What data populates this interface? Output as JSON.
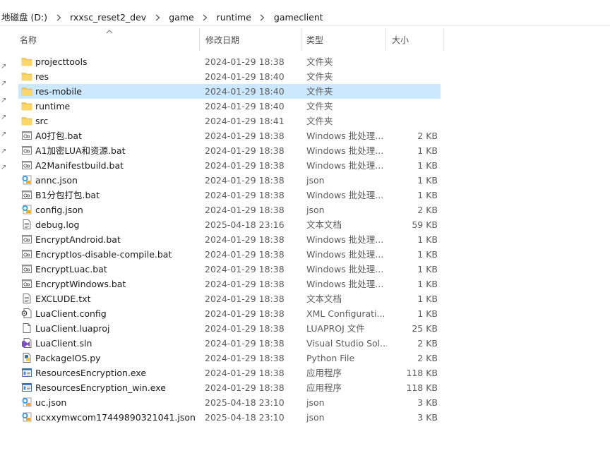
{
  "breadcrumb": [
    "地磁盘 (D:)",
    "rxxsc_reset2_dev",
    "game",
    "runtime",
    "gameclient"
  ],
  "columns": {
    "name": "名称",
    "date": "修改日期",
    "type": "类型",
    "size": "大小"
  },
  "files": [
    {
      "icon": "folder-icon",
      "name": "projecttools",
      "date": "2024-01-29 18:38",
      "type": "文件夹",
      "size": ""
    },
    {
      "icon": "folder-icon",
      "name": "res",
      "date": "2024-01-29 18:40",
      "type": "文件夹",
      "size": ""
    },
    {
      "icon": "folder-icon",
      "name": "res-mobile",
      "date": "2024-01-29 18:40",
      "type": "文件夹",
      "size": "",
      "selected": true
    },
    {
      "icon": "folder-icon",
      "name": "runtime",
      "date": "2024-01-29 18:40",
      "type": "文件夹",
      "size": ""
    },
    {
      "icon": "folder-icon",
      "name": "src",
      "date": "2024-01-29 18:41",
      "type": "文件夹",
      "size": ""
    },
    {
      "icon": "batch-file-icon",
      "name": "A0打包.bat",
      "date": "2024-01-29 18:38",
      "type": "Windows 批处理...",
      "size": "2 KB"
    },
    {
      "icon": "batch-file-icon",
      "name": "A1加密LUA和资源.bat",
      "date": "2024-01-29 18:38",
      "type": "Windows 批处理...",
      "size": "1 KB"
    },
    {
      "icon": "batch-file-icon",
      "name": "A2Manifestbuild.bat",
      "date": "2024-01-29 18:38",
      "type": "Windows 批处理...",
      "size": "1 KB"
    },
    {
      "icon": "json-file-icon",
      "name": "annc.json",
      "date": "2024-01-29 18:38",
      "type": "json",
      "size": "1 KB"
    },
    {
      "icon": "batch-file-icon",
      "name": "B1分包打包.bat",
      "date": "2024-01-29 18:38",
      "type": "Windows 批处理...",
      "size": "1 KB"
    },
    {
      "icon": "json-file-icon",
      "name": "config.json",
      "date": "2024-01-29 18:38",
      "type": "json",
      "size": "2 KB"
    },
    {
      "icon": "text-file-icon",
      "name": "debug.log",
      "date": "2025-04-18 23:16",
      "type": "文本文档",
      "size": "59 KB"
    },
    {
      "icon": "batch-file-icon",
      "name": "EncryptAndroid.bat",
      "date": "2024-01-29 18:38",
      "type": "Windows 批处理...",
      "size": "1 KB"
    },
    {
      "icon": "batch-file-icon",
      "name": "EncryptIos-disable-compile.bat",
      "date": "2024-01-29 18:38",
      "type": "Windows 批处理...",
      "size": "1 KB"
    },
    {
      "icon": "batch-file-icon",
      "name": "EncryptLuac.bat",
      "date": "2024-01-29 18:38",
      "type": "Windows 批处理...",
      "size": "1 KB"
    },
    {
      "icon": "batch-file-icon",
      "name": "EncryptWindows.bat",
      "date": "2024-01-29 18:38",
      "type": "Windows 批处理...",
      "size": "1 KB"
    },
    {
      "icon": "text-file-icon",
      "name": "EXCLUDE.txt",
      "date": "2024-01-29 18:38",
      "type": "文本文档",
      "size": "1 KB"
    },
    {
      "icon": "config-file-icon",
      "name": "LuaClient.config",
      "date": "2024-01-29 18:38",
      "type": "XML Configurati...",
      "size": "1 KB"
    },
    {
      "icon": "blank-file-icon",
      "name": "LuaClient.luaproj",
      "date": "2024-01-29 18:38",
      "type": "LUAPROJ 文件",
      "size": "25 KB"
    },
    {
      "icon": "visual-studio-icon",
      "name": "LuaClient.sln",
      "date": "2024-01-29 18:38",
      "type": "Visual Studio Sol...",
      "size": "2 KB"
    },
    {
      "icon": "python-file-icon",
      "name": "PackageIOS.py",
      "date": "2024-01-29 18:38",
      "type": "Python File",
      "size": "2 KB"
    },
    {
      "icon": "exe-file-icon",
      "name": "ResourcesEncryption.exe",
      "date": "2024-01-29 18:38",
      "type": "应用程序",
      "size": "118 KB"
    },
    {
      "icon": "exe-file-icon",
      "name": "ResourcesEncryption_win.exe",
      "date": "2024-01-29 18:38",
      "type": "应用程序",
      "size": "118 KB"
    },
    {
      "icon": "json-file-icon",
      "name": "uc.json",
      "date": "2025-04-18 23:10",
      "type": "json",
      "size": "3 KB"
    },
    {
      "icon": "json-file-icon",
      "name": "ucxxymwcom17449890321041.json",
      "date": "2025-04-18 23:10",
      "type": "json",
      "size": "3 KB"
    }
  ],
  "colors": {
    "selection": "#cce8ff",
    "folder": "#f8c94a",
    "header_text": "#4b4b4b",
    "secondary_text": "#5c5c5c"
  }
}
